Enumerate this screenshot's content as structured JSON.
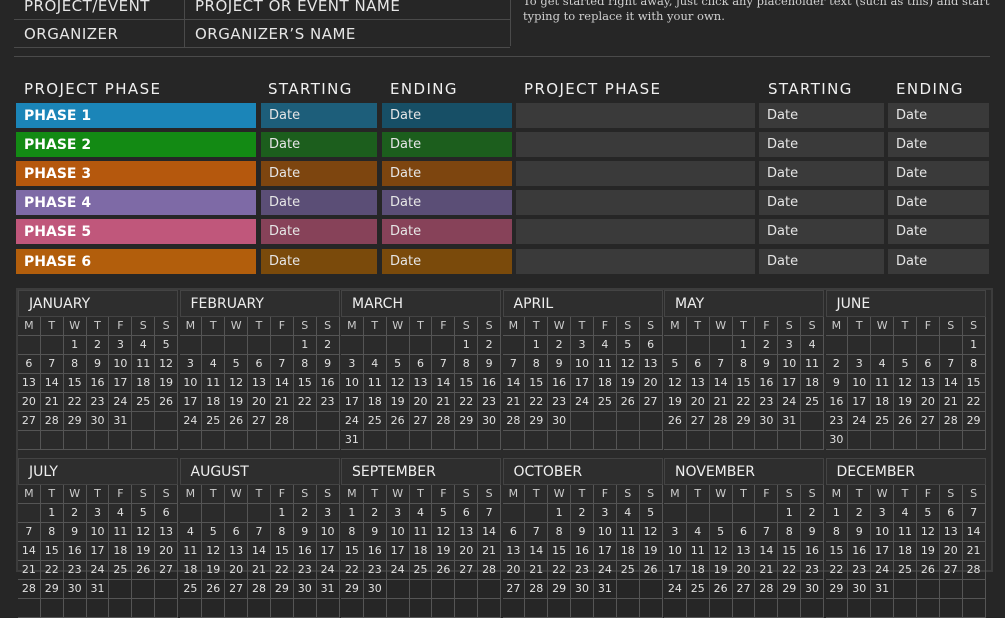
{
  "header": {
    "rows": [
      {
        "label": "PROJECT/EVENT",
        "value": "PROJECT OR EVENT NAME"
      },
      {
        "label": "ORGANIZER",
        "value": "ORGANIZER’S NAME"
      }
    ],
    "hint": "To get started right away, just click any placeholder text (such as this) and start typing to replace it with your own."
  },
  "phase_table": {
    "headers": {
      "phase": "PROJECT PHASE",
      "start": "STARTING",
      "end": "ENDING"
    },
    "left": [
      {
        "name": "PHASE 1",
        "start": "Date",
        "end": "Date",
        "color": "#1b85b8",
        "start_color": "#1d5e7a",
        "end_color": "#174f66"
      },
      {
        "name": "PHASE 2",
        "start": "Date",
        "end": "Date",
        "color": "#138a14",
        "start_color": "#1c5e1d",
        "end_color": "#1c5e1d"
      },
      {
        "name": "PHASE 3",
        "start": "Date",
        "end": "Date",
        "color": "#b5580d",
        "start_color": "#7d450f",
        "end_color": "#7d450f"
      },
      {
        "name": "PHASE 4",
        "start": "Date",
        "end": "Date",
        "color": "#7e6aa6",
        "start_color": "#5b4e76",
        "end_color": "#5b4e76"
      },
      {
        "name": "PHASE 5",
        "start": "Date",
        "end": "Date",
        "color": "#c0577b",
        "start_color": "#874259",
        "end_color": "#874259"
      },
      {
        "name": "PHASE 6",
        "start": "Date",
        "end": "Date",
        "color": "#b25e0c",
        "start_color": "#7a4a0b",
        "end_color": "#7a4a0b"
      }
    ],
    "right": [
      {
        "name": "",
        "start": "Date",
        "end": "Date"
      },
      {
        "name": "",
        "start": "Date",
        "end": "Date"
      },
      {
        "name": "",
        "start": "Date",
        "end": "Date"
      },
      {
        "name": "",
        "start": "Date",
        "end": "Date"
      },
      {
        "name": "",
        "start": "Date",
        "end": "Date"
      },
      {
        "name": "",
        "start": "Date",
        "end": "Date"
      }
    ],
    "right_color": "#3a3a3a"
  },
  "calendar": {
    "day_headers": [
      "M",
      "T",
      "W",
      "T",
      "F",
      "S",
      "S"
    ],
    "months": [
      {
        "name": "JANUARY",
        "offset": 2,
        "days": 31
      },
      {
        "name": "FEBRUARY",
        "offset": 5,
        "days": 28
      },
      {
        "name": "MARCH",
        "offset": 5,
        "days": 31
      },
      {
        "name": "APRIL",
        "offset": 1,
        "days": 30
      },
      {
        "name": "MAY",
        "offset": 3,
        "days": 31
      },
      {
        "name": "JUNE",
        "offset": 6,
        "days": 30
      },
      {
        "name": "JULY",
        "offset": 1,
        "days": 31
      },
      {
        "name": "AUGUST",
        "offset": 4,
        "days": 31
      },
      {
        "name": "SEPTEMBER",
        "offset": 0,
        "days": 30
      },
      {
        "name": "OCTOBER",
        "offset": 2,
        "days": 31
      },
      {
        "name": "NOVEMBER",
        "offset": 5,
        "days": 30
      },
      {
        "name": "DECEMBER",
        "offset": 0,
        "days": 31
      }
    ]
  }
}
